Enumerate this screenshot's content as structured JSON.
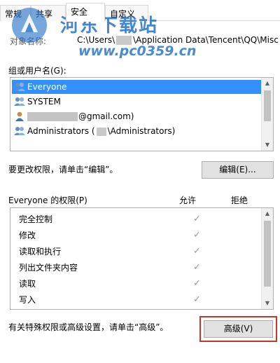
{
  "tabs": [
    {
      "label": "常规"
    },
    {
      "label": "共享"
    },
    {
      "label": "安全"
    },
    {
      "label": "自定义"
    }
  ],
  "watermark": {
    "title": "河东下载站",
    "url": "www.pc0359.cn"
  },
  "object_name": {
    "label": "对象名称:",
    "value_start": "C:\\Users\\",
    "value_end": "\\Application Data\\Tencent\\QQ\\Misc"
  },
  "group_label": "组或用户名(G):",
  "users": [
    {
      "name": "Everyone"
    },
    {
      "name": "SYSTEM"
    },
    {
      "name": "@gmail.com)"
    },
    {
      "name_start": "Administrators (",
      "name_end": "\\Administrators)"
    }
  ],
  "edit_hint": "要更改权限，请单击“编辑”。",
  "edit_button": "编辑(E)...",
  "permissions_header": {
    "name": "Everyone 的权限(P)",
    "allow": "允许",
    "deny": "拒绝"
  },
  "permissions": [
    {
      "name": "完全控制",
      "allow_mark": "✓"
    },
    {
      "name": "修改",
      "allow_mark": "✓"
    },
    {
      "name": "读取和执行",
      "allow_mark": "✓"
    },
    {
      "name": "列出文件夹内容",
      "allow_mark": "✓"
    },
    {
      "name": "读取",
      "allow_mark": "✓"
    },
    {
      "name": "写入",
      "allow_mark": "✓"
    }
  ],
  "advanced_hint": "有关特殊权限或高级设置，请单击“高级”。",
  "advanced_button": "高级(V)",
  "colors": {
    "selection": "#3390ff",
    "watermark": "#2a76c9",
    "highlight_frame": "#c0392b"
  }
}
